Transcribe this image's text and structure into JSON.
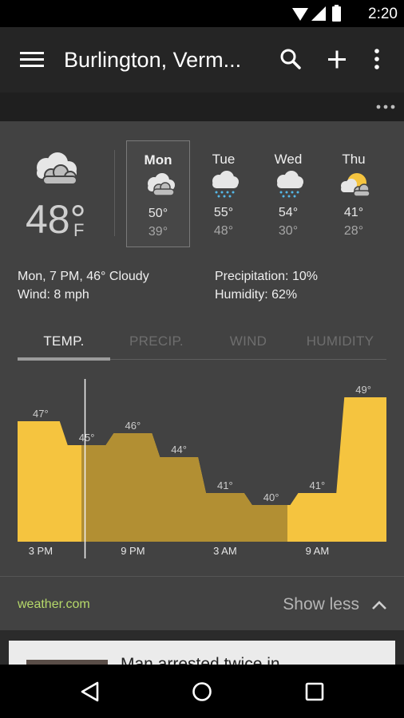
{
  "status_bar": {
    "time": "2:20"
  },
  "app_bar": {
    "title": "Burlington, Verm..."
  },
  "current": {
    "temp": "48°",
    "unit": "F",
    "condition_icon": "cloudy-icon"
  },
  "forecast": [
    {
      "day": "Mon",
      "hi": "50°",
      "lo": "39°",
      "icon": "cloudy-icon",
      "selected": true
    },
    {
      "day": "Tue",
      "hi": "55°",
      "lo": "48°",
      "icon": "rain-icon",
      "selected": false
    },
    {
      "day": "Wed",
      "hi": "54°",
      "lo": "30°",
      "icon": "rain-icon",
      "selected": false
    },
    {
      "day": "Thu",
      "hi": "41°",
      "lo": "28°",
      "icon": "partly-sunny-icon",
      "selected": false
    }
  ],
  "details": {
    "time_condition": "Mon, 7 PM, 46° Cloudy",
    "wind": "Wind: 8 mph",
    "precipitation": "Precipitation: 10%",
    "humidity": "Humidity: 62%"
  },
  "tabs": [
    "TEMP.",
    "PRECIP.",
    "WIND",
    "HUMIDITY"
  ],
  "active_tab": "TEMP.",
  "colors": {
    "chart_bright": "#f5c43f",
    "chart_dim": "#b28f33",
    "source_link": "#b6d96a"
  },
  "chart_data": {
    "type": "area",
    "step": true,
    "values": [
      47,
      45,
      46,
      44,
      41,
      40,
      41,
      49
    ],
    "value_labels": [
      "47°",
      "45°",
      "46°",
      "44°",
      "41°",
      "40°",
      "41°",
      "49°"
    ],
    "x_ticks": [
      "3 PM",
      "9 PM",
      "3 AM",
      "9 AM"
    ],
    "current_index": 2
  },
  "footer": {
    "source": "weather.com",
    "show_less": "Show less"
  },
  "news": {
    "headline": "Man arrested twice in"
  }
}
